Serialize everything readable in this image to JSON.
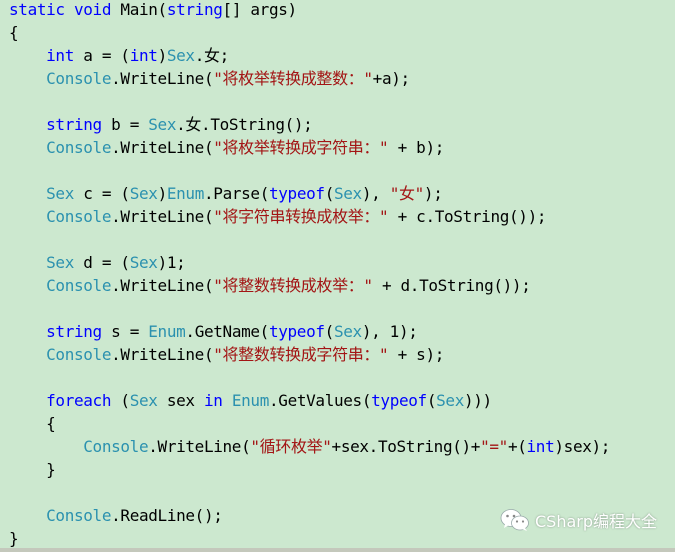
{
  "editor": {
    "background": "#cce8cf",
    "colors": {
      "keyword": "#0000ff",
      "type": "#2b91af",
      "string": "#a31515",
      "plain": "#000000"
    },
    "lines": [
      [
        {
          "t": "static void ",
          "c": "kw"
        },
        {
          "t": "Main(",
          "c": "pl"
        },
        {
          "t": "string",
          "c": "kw"
        },
        {
          "t": "[] args)",
          "c": "pl"
        }
      ],
      [
        {
          "t": "{",
          "c": "pl"
        }
      ],
      [
        {
          "t": "    ",
          "c": "pl"
        },
        {
          "t": "int",
          "c": "kw"
        },
        {
          "t": " a = (",
          "c": "pl"
        },
        {
          "t": "int",
          "c": "kw"
        },
        {
          "t": ")",
          "c": "pl"
        },
        {
          "t": "Sex",
          "c": "ty"
        },
        {
          "t": ".女;",
          "c": "pl"
        }
      ],
      [
        {
          "t": "    ",
          "c": "pl"
        },
        {
          "t": "Console",
          "c": "ty"
        },
        {
          "t": ".WriteLine(",
          "c": "pl"
        },
        {
          "t": "\"将枚举转换成整数：\"",
          "c": "str"
        },
        {
          "t": "+a);",
          "c": "pl"
        }
      ],
      [
        {
          "t": "",
          "c": "pl"
        }
      ],
      [
        {
          "t": "    ",
          "c": "pl"
        },
        {
          "t": "string",
          "c": "kw"
        },
        {
          "t": " b = ",
          "c": "pl"
        },
        {
          "t": "Sex",
          "c": "ty"
        },
        {
          "t": ".女.ToString();",
          "c": "pl"
        }
      ],
      [
        {
          "t": "    ",
          "c": "pl"
        },
        {
          "t": "Console",
          "c": "ty"
        },
        {
          "t": ".WriteLine(",
          "c": "pl"
        },
        {
          "t": "\"将枚举转换成字符串：\"",
          "c": "str"
        },
        {
          "t": " + b);",
          "c": "pl"
        }
      ],
      [
        {
          "t": "",
          "c": "pl"
        }
      ],
      [
        {
          "t": "    ",
          "c": "pl"
        },
        {
          "t": "Sex",
          "c": "ty"
        },
        {
          "t": " c = (",
          "c": "pl"
        },
        {
          "t": "Sex",
          "c": "ty"
        },
        {
          "t": ")",
          "c": "pl"
        },
        {
          "t": "Enum",
          "c": "ty"
        },
        {
          "t": ".Parse(",
          "c": "pl"
        },
        {
          "t": "typeof",
          "c": "kw"
        },
        {
          "t": "(",
          "c": "pl"
        },
        {
          "t": "Sex",
          "c": "ty"
        },
        {
          "t": "), ",
          "c": "pl"
        },
        {
          "t": "\"女\"",
          "c": "str"
        },
        {
          "t": ");",
          "c": "pl"
        }
      ],
      [
        {
          "t": "    ",
          "c": "pl"
        },
        {
          "t": "Console",
          "c": "ty"
        },
        {
          "t": ".WriteLine(",
          "c": "pl"
        },
        {
          "t": "\"将字符串转换成枚举：\"",
          "c": "str"
        },
        {
          "t": " + c.ToString());",
          "c": "pl"
        }
      ],
      [
        {
          "t": "",
          "c": "pl"
        }
      ],
      [
        {
          "t": "    ",
          "c": "pl"
        },
        {
          "t": "Sex",
          "c": "ty"
        },
        {
          "t": " d = (",
          "c": "pl"
        },
        {
          "t": "Sex",
          "c": "ty"
        },
        {
          "t": ")1;",
          "c": "pl"
        }
      ],
      [
        {
          "t": "    ",
          "c": "pl"
        },
        {
          "t": "Console",
          "c": "ty"
        },
        {
          "t": ".WriteLine(",
          "c": "pl"
        },
        {
          "t": "\"将整数转换成枚举：\"",
          "c": "str"
        },
        {
          "t": " + d.ToString());",
          "c": "pl"
        }
      ],
      [
        {
          "t": "",
          "c": "pl"
        }
      ],
      [
        {
          "t": "    ",
          "c": "pl"
        },
        {
          "t": "string",
          "c": "kw"
        },
        {
          "t": " s = ",
          "c": "pl"
        },
        {
          "t": "Enum",
          "c": "ty"
        },
        {
          "t": ".GetName(",
          "c": "pl"
        },
        {
          "t": "typeof",
          "c": "kw"
        },
        {
          "t": "(",
          "c": "pl"
        },
        {
          "t": "Sex",
          "c": "ty"
        },
        {
          "t": "), 1);",
          "c": "pl"
        }
      ],
      [
        {
          "t": "    ",
          "c": "pl"
        },
        {
          "t": "Console",
          "c": "ty"
        },
        {
          "t": ".WriteLine(",
          "c": "pl"
        },
        {
          "t": "\"将整数转换成字符串：\"",
          "c": "str"
        },
        {
          "t": " + s);",
          "c": "pl"
        }
      ],
      [
        {
          "t": "",
          "c": "pl"
        }
      ],
      [
        {
          "t": "    ",
          "c": "pl"
        },
        {
          "t": "foreach",
          "c": "kw"
        },
        {
          "t": " (",
          "c": "pl"
        },
        {
          "t": "Sex",
          "c": "ty"
        },
        {
          "t": " sex ",
          "c": "pl"
        },
        {
          "t": "in",
          "c": "kw"
        },
        {
          "t": " ",
          "c": "pl"
        },
        {
          "t": "Enum",
          "c": "ty"
        },
        {
          "t": ".GetValues(",
          "c": "pl"
        },
        {
          "t": "typeof",
          "c": "kw"
        },
        {
          "t": "(",
          "c": "pl"
        },
        {
          "t": "Sex",
          "c": "ty"
        },
        {
          "t": ")))",
          "c": "pl"
        }
      ],
      [
        {
          "t": "    {",
          "c": "pl"
        }
      ],
      [
        {
          "t": "        ",
          "c": "pl"
        },
        {
          "t": "Console",
          "c": "ty"
        },
        {
          "t": ".WriteLine(",
          "c": "pl"
        },
        {
          "t": "\"循环枚举\"",
          "c": "str"
        },
        {
          "t": "+sex.ToString()+",
          "c": "pl"
        },
        {
          "t": "\"=\"",
          "c": "str"
        },
        {
          "t": "+(",
          "c": "pl"
        },
        {
          "t": "int",
          "c": "kw"
        },
        {
          "t": ")sex);",
          "c": "pl"
        }
      ],
      [
        {
          "t": "    }",
          "c": "pl"
        }
      ],
      [
        {
          "t": "",
          "c": "pl"
        }
      ],
      [
        {
          "t": "    ",
          "c": "pl"
        },
        {
          "t": "Console",
          "c": "ty"
        },
        {
          "t": ".ReadLine();",
          "c": "pl"
        }
      ],
      [
        {
          "t": "}",
          "c": "pl"
        }
      ]
    ]
  },
  "watermark": {
    "icon": "wechat-icon",
    "text": "CSharp编程大全"
  }
}
